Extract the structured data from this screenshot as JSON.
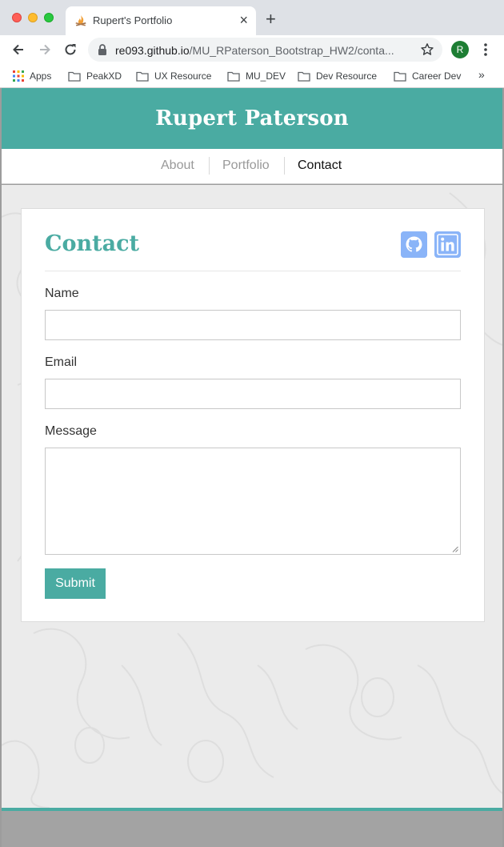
{
  "browser": {
    "tab_title": "Rupert's Portfolio",
    "tab_close": "×",
    "new_tab": "+",
    "url_host": "re093.github.io",
    "url_path": "/MU_RPaterson_Bootstrap_HW2/conta...",
    "profile_initial": "R",
    "bookmarks": [
      {
        "label": "Apps",
        "icon": "apps-grid-icon"
      },
      {
        "label": "PeakXD",
        "icon": "folder-icon"
      },
      {
        "label": "UX Resource",
        "icon": "folder-icon"
      },
      {
        "label": "MU_DEV",
        "icon": "folder-icon"
      },
      {
        "label": "Dev Resource",
        "icon": "folder-icon"
      },
      {
        "label": "Career Dev",
        "icon": "folder-icon"
      }
    ],
    "bookmarks_more": "»"
  },
  "site": {
    "title": "Rupert Paterson",
    "accent_color": "#4aaba2",
    "nav": [
      {
        "label": "About",
        "active": false
      },
      {
        "label": "Portfolio",
        "active": false
      },
      {
        "label": "Contact",
        "active": true
      }
    ]
  },
  "contact": {
    "heading": "Contact",
    "social_icons": [
      "github-icon",
      "linkedin-icon"
    ],
    "fields": [
      {
        "label": "Name",
        "value": ""
      },
      {
        "label": "Email",
        "value": ""
      },
      {
        "label": "Message",
        "value": ""
      }
    ],
    "submit_label": "Submit"
  }
}
